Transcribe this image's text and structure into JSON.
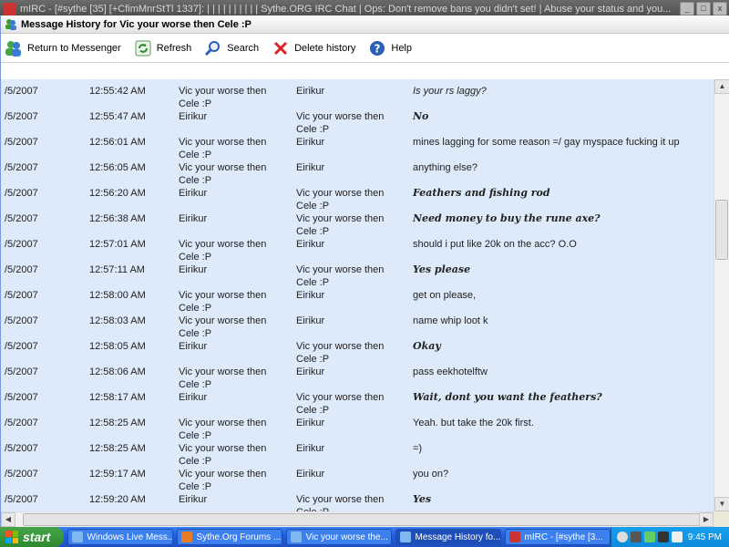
{
  "background_window": {
    "title": "mIRC - [#sythe [35] [+CfimMnrStTl 1337]: | | | | | | | | | | Sythe.ORG IRC Chat | Ops: Don't remove bans you didn't set! | Abuse your status and you..."
  },
  "window": {
    "title": "Message History for Vic your worse then Cele :P"
  },
  "toolbar": {
    "return_label": "Return to Messenger",
    "refresh_label": "Refresh",
    "search_label": "Search",
    "delete_label": "Delete history",
    "help_label": "Help"
  },
  "messages": [
    {
      "date": "/5/2007",
      "time": "12:55:42 AM",
      "from": "Vic your worse then Cele :P",
      "to": "Eirikur",
      "text": "Is your rs laggy?",
      "style": "italic"
    },
    {
      "date": "/5/2007",
      "time": "12:55:47 AM",
      "from": "Eirikur",
      "to": "Vic your worse then Cele :P",
      "text": "No",
      "style": "serif"
    },
    {
      "date": "/5/2007",
      "time": "12:56:01 AM",
      "from": "Vic your worse then Cele :P",
      "to": "Eirikur",
      "text": "mines lagging for some reason =/ gay myspace fucking it up",
      "style": "normal"
    },
    {
      "date": "/5/2007",
      "time": "12:56:05 AM",
      "from": "Vic your worse then Cele :P",
      "to": "Eirikur",
      "text": "anything else?",
      "style": "normal"
    },
    {
      "date": "/5/2007",
      "time": "12:56:20 AM",
      "from": "Eirikur",
      "to": "Vic your worse then Cele :P",
      "text": "Feathers and fishing rod",
      "style": "serif"
    },
    {
      "date": "/5/2007",
      "time": "12:56:38 AM",
      "from": "Eirikur",
      "to": "Vic your worse then Cele :P",
      "text": "Need money to buy the rune axe?",
      "style": "serif"
    },
    {
      "date": "/5/2007",
      "time": "12:57:01 AM",
      "from": "Vic your worse then Cele :P",
      "to": "Eirikur",
      "text": "should i put like 20k on the acc? O.O",
      "style": "normal"
    },
    {
      "date": "/5/2007",
      "time": "12:57:11 AM",
      "from": "Eirikur",
      "to": "Vic your worse then Cele :P",
      "text": "Yes please",
      "style": "serif"
    },
    {
      "date": "/5/2007",
      "time": "12:58:00 AM",
      "from": "Vic your worse then Cele :P",
      "to": "Eirikur",
      "text": "get on please,",
      "style": "normal"
    },
    {
      "date": "/5/2007",
      "time": "12:58:03 AM",
      "from": "Vic your worse then Cele :P",
      "to": "Eirikur",
      "text": "name whip loot k",
      "style": "normal"
    },
    {
      "date": "/5/2007",
      "time": "12:58:05 AM",
      "from": "Eirikur",
      "to": "Vic your worse then Cele :P",
      "text": "Okay",
      "style": "serif"
    },
    {
      "date": "/5/2007",
      "time": "12:58:06 AM",
      "from": "Vic your worse then Cele :P",
      "to": "Eirikur",
      "text": "pass eekhotelftw",
      "style": "normal"
    },
    {
      "date": "/5/2007",
      "time": "12:58:17 AM",
      "from": "Eirikur",
      "to": "Vic your worse then Cele :P",
      "text": "Wait, dont you want the feathers?",
      "style": "serif"
    },
    {
      "date": "/5/2007",
      "time": "12:58:25 AM",
      "from": "Vic your worse then Cele :P",
      "to": "Eirikur",
      "text": "Yeah. but take the 20k first.",
      "style": "normal"
    },
    {
      "date": "/5/2007",
      "time": "12:58:25 AM",
      "from": "Vic your worse then Cele :P",
      "to": "Eirikur",
      "text": "=)",
      "style": "normal"
    },
    {
      "date": "/5/2007",
      "time": "12:59:17 AM",
      "from": "Vic your worse then Cele :P",
      "to": "Eirikur",
      "text": "you on?",
      "style": "normal"
    },
    {
      "date": "/5/2007",
      "time": "12:59:20 AM",
      "from": "Eirikur",
      "to": "Vic your worse then Cele :P",
      "text": "Yes",
      "style": "serif"
    }
  ],
  "taskbar": {
    "start_label": "start",
    "tasks": [
      {
        "label": "Windows Live Mess...",
        "icon": "msn-icon",
        "color": "#7fb8ef"
      },
      {
        "label": "Sythe.Org Forums ...",
        "icon": "firefox-icon",
        "color": "#e77b23"
      },
      {
        "label": "Vic your worse the...",
        "icon": "msn-icon",
        "color": "#7fb8ef"
      },
      {
        "label": "Message History fo...",
        "icon": "msn-icon",
        "color": "#7fb8ef",
        "active": true
      },
      {
        "label": "mIRC - [#sythe [3...",
        "icon": "mirc-icon",
        "color": "#cc3333"
      }
    ],
    "clock": "9:45 PM"
  }
}
